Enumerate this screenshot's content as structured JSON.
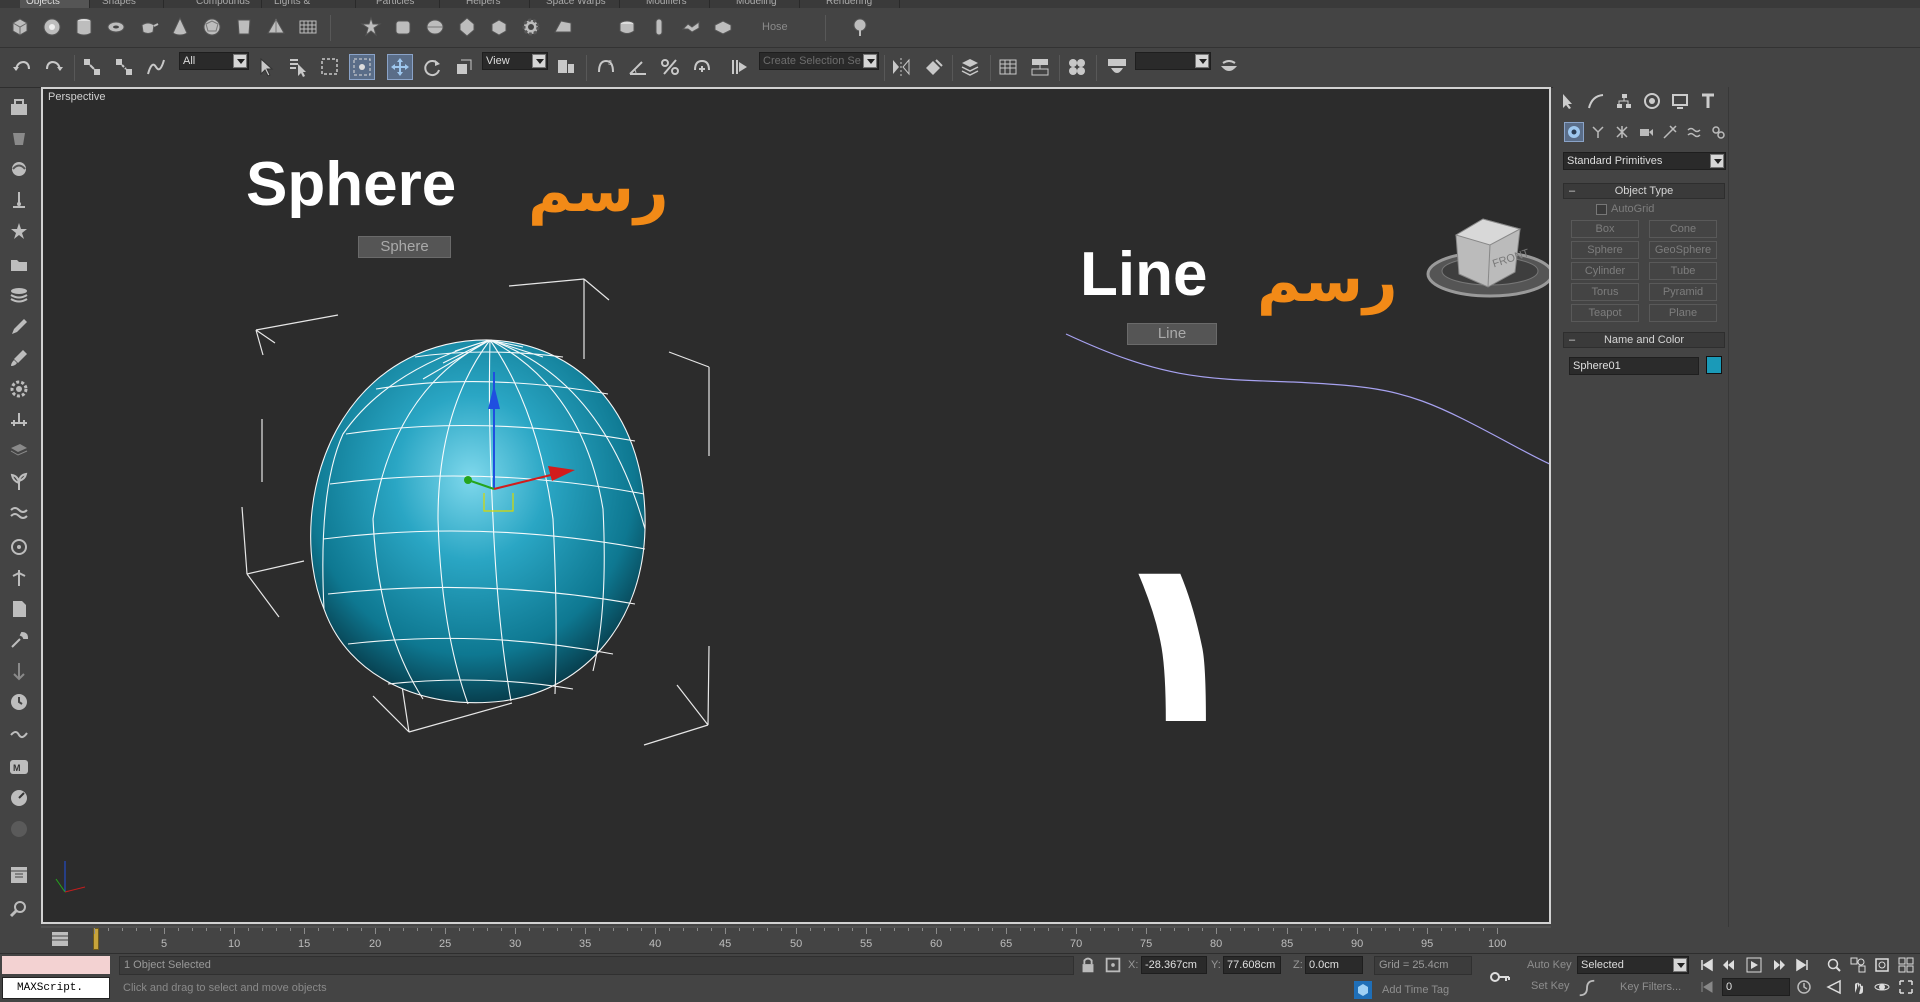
{
  "colors": {
    "viewport_bg": "#2c2c2c",
    "ui_bg": "#444444",
    "sphere": "#1a9ab8",
    "accent_orange": "#f28a17",
    "curve": "#a7a2f0",
    "swatch": "#1a9ab8"
  },
  "menu_tabs": [
    "Objects",
    "Shapes",
    "Compounds",
    "Lights & Cameras",
    "Particles",
    "Helpers",
    "Space Warps",
    "Modifiers",
    "Modeling",
    "Rendering"
  ],
  "toolbar": {
    "hose_label": "Hose",
    "selection_filter": "All",
    "ref_coord": "View",
    "named_selection_placeholder": "Create Selection Se",
    "render_preset": ""
  },
  "viewport": {
    "label": "Perspective",
    "sphere_title_en": "Sphere",
    "sphere_title_ar": "رسم",
    "sphere_tag": "Sphere",
    "line_title_en": "Line",
    "line_title_ar": "رسم",
    "line_tag": "Line",
    "big_digit": "١",
    "viewcube_label": "FRONT"
  },
  "command_panel": {
    "category_dropdown": "Standard Primitives",
    "object_type_header": "Object Type",
    "autogrid_label": "AutoGrid",
    "buttons": [
      "Box",
      "Cone",
      "Sphere",
      "GeoSphere",
      "Cylinder",
      "Tube",
      "Torus",
      "Pyramid",
      "Teapot",
      "Plane"
    ],
    "name_color_header": "Name and Color",
    "object_name": "Sphere01"
  },
  "timeline": {
    "ticks": [
      "5",
      "10",
      "15",
      "20",
      "25",
      "30",
      "35",
      "40",
      "45",
      "50",
      "55",
      "60",
      "65",
      "70",
      "75",
      "80",
      "85",
      "90",
      "95",
      "100"
    ]
  },
  "status": {
    "maxscript_label": "MAXScript.",
    "selection_status": "1 Object Selected",
    "prompt": "Click and drag to select and move objects",
    "x_label": "X:",
    "x_value": "-28.367cm",
    "y_label": "Y:",
    "y_value": "77.608cm",
    "z_label": "Z:",
    "z_value": "0.0cm",
    "grid": "Grid = 25.4cm",
    "add_time_tag": "Add Time Tag",
    "auto_key": "Auto Key",
    "set_key": "Set Key",
    "key_mode": "Selected",
    "key_filters": "Key Filters...",
    "frame": "0"
  }
}
